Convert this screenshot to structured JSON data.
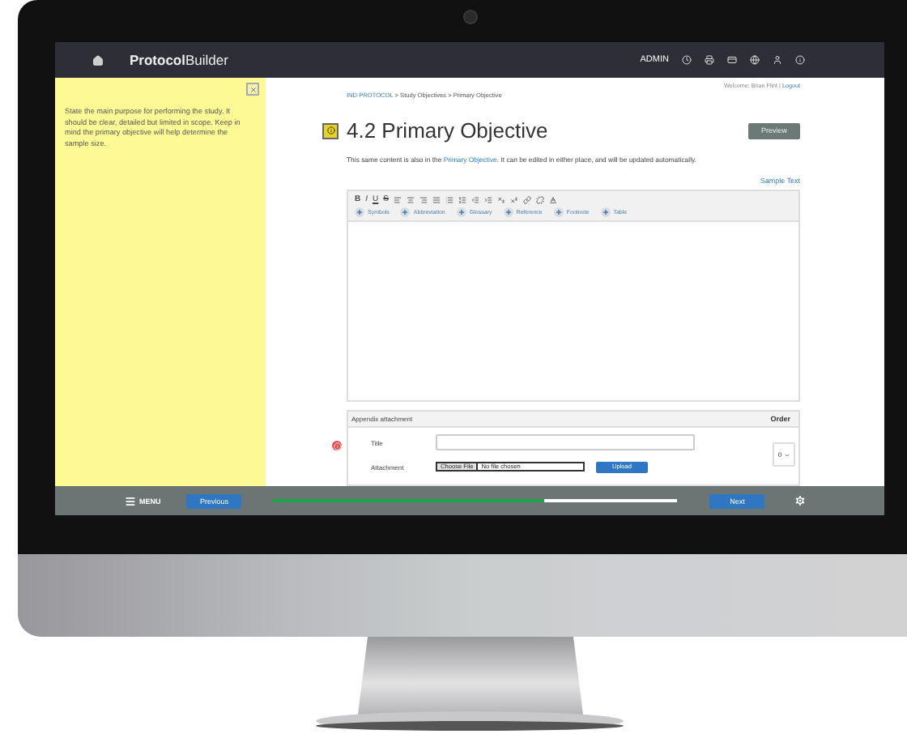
{
  "header": {
    "brand_bold": "Protocol",
    "brand_light": "Builder",
    "role": "ADMIN"
  },
  "help_panel": {
    "text": "State the main purpose for performing the study. It should be clear, detailed but limited in scope. Keep in mind the primary objective will help determine the sample size."
  },
  "breadcrumb": {
    "link": "IND PROTOCOL",
    "rest": "> Study Objectives > Primary Objective"
  },
  "welcome": {
    "text": "Welcome: Brian Flint |",
    "link": "Logout"
  },
  "title": "4.2 Primary Objective",
  "preview": "Preview",
  "notice": {
    "before": "This same content is also in the",
    "link": "Primary Objective",
    "after": ". It can be edited in either place, and will be updated automatically."
  },
  "sample_link": "Sample Text",
  "editor": {
    "format_buttons": [
      "B",
      "I",
      "U",
      "S"
    ],
    "insert_buttons": [
      "Symbols",
      "Abbreviation",
      "Glossary",
      "Reference",
      "Footnote",
      "Table"
    ]
  },
  "appendix": {
    "title": "Appendix attachment",
    "order_label": "Order",
    "order_value": "0",
    "fields": [
      {
        "label": "Title",
        "kind": "text"
      },
      {
        "label": "Attachment",
        "kind": "file",
        "button": "Choose File",
        "status": "No file chosen",
        "action": "Upload"
      }
    ]
  },
  "footer": {
    "menu": "MENU",
    "previous": "Previous",
    "next": "Next",
    "progress": {
      "level": 0.67
    }
  }
}
